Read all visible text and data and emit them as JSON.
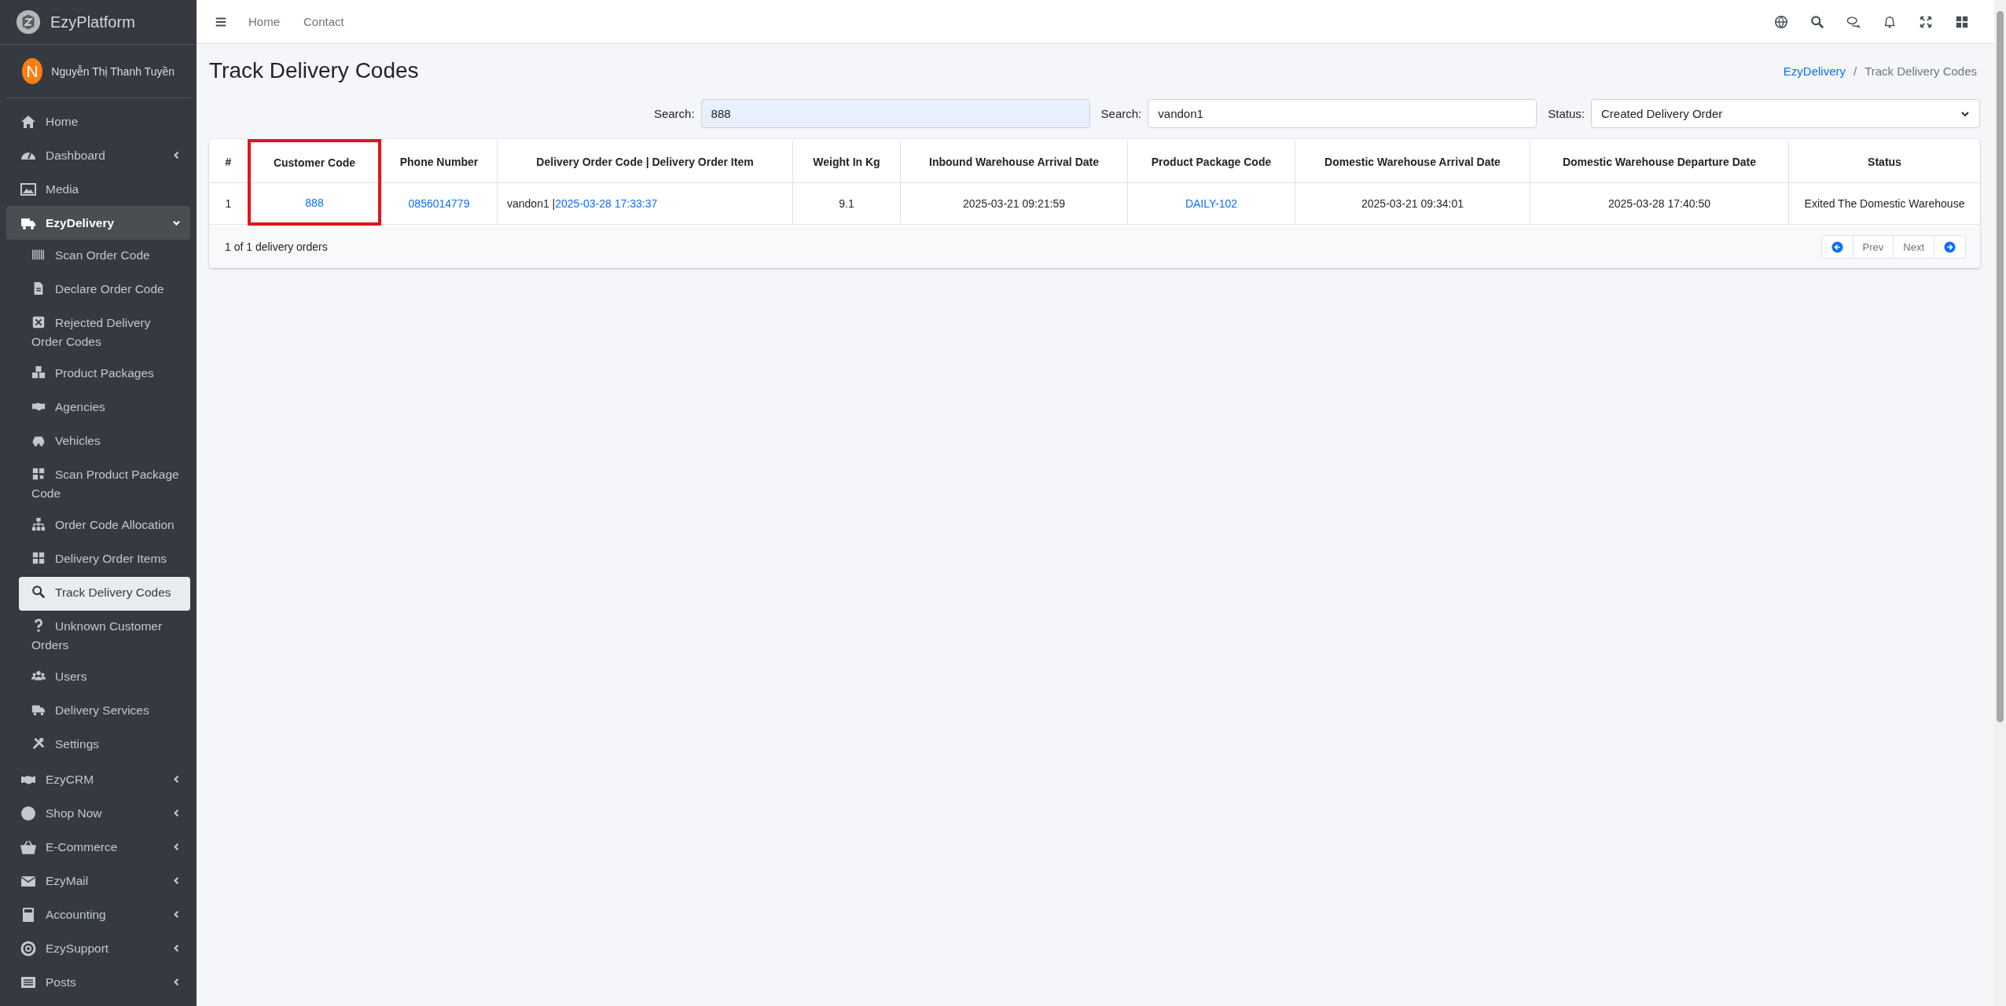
{
  "brand": {
    "name": "EzyPlatform"
  },
  "user": {
    "initial": "N",
    "name": "Nguyễn Thị Thanh Tuyền"
  },
  "sidebar": {
    "items": [
      {
        "label": "Home",
        "kind": "link"
      },
      {
        "label": "Dashboard",
        "kind": "group",
        "expanded": false
      },
      {
        "label": "Media",
        "kind": "link"
      },
      {
        "label": "EzyDelivery",
        "kind": "group",
        "expanded": true,
        "children": [
          {
            "label": "Scan Order Code",
            "selected": false
          },
          {
            "label": "Declare Order Code",
            "selected": false
          },
          {
            "label": "Rejected Delivery Order Codes",
            "selected": false
          },
          {
            "label": "Product Packages",
            "selected": false
          },
          {
            "label": "Agencies",
            "selected": false
          },
          {
            "label": "Vehicles",
            "selected": false
          },
          {
            "label": "Scan Product Package Code",
            "selected": false
          },
          {
            "label": "Order Code Allocation",
            "selected": false
          },
          {
            "label": "Delivery Order Items",
            "selected": false
          },
          {
            "label": "Track Delivery Codes",
            "selected": true
          },
          {
            "label": "Unknown Customer Orders",
            "selected": false
          },
          {
            "label": "Users",
            "selected": false
          },
          {
            "label": "Delivery Services",
            "selected": false
          },
          {
            "label": "Settings",
            "selected": false
          }
        ]
      },
      {
        "label": "EzyCRM",
        "kind": "group",
        "expanded": false
      },
      {
        "label": "Shop Now",
        "kind": "group",
        "expanded": false
      },
      {
        "label": "E-Commerce",
        "kind": "group",
        "expanded": false
      },
      {
        "label": "EzyMail",
        "kind": "group",
        "expanded": false
      },
      {
        "label": "Accounting",
        "kind": "group",
        "expanded": false
      },
      {
        "label": "EzySupport",
        "kind": "group",
        "expanded": false
      },
      {
        "label": "Posts",
        "kind": "group",
        "expanded": false
      }
    ]
  },
  "topbar": {
    "links": [
      "Home",
      "Contact"
    ]
  },
  "page": {
    "title": "Track Delivery Codes",
    "breadcrumb_separator": "/",
    "breadcrumb": [
      {
        "label": "EzyDelivery",
        "kind": "link"
      },
      {
        "label": "Track Delivery Codes",
        "kind": "current"
      }
    ]
  },
  "filters": [
    {
      "label": "Search:",
      "kind": "input",
      "value": "888",
      "focused": true
    },
    {
      "label": "Search:",
      "kind": "input",
      "value": "vandon1",
      "focused": false
    },
    {
      "label": "Status:",
      "kind": "select",
      "value": "Created Delivery Order",
      "focused": false
    }
  ],
  "table": {
    "columns": [
      {
        "label": "#",
        "highlighted": false
      },
      {
        "label": "Customer Code",
        "highlighted": true
      },
      {
        "label": "Phone Number",
        "highlighted": false
      },
      {
        "label": "Delivery Order Code | Delivery Order Item",
        "highlighted": false
      },
      {
        "label": "Weight In Kg",
        "highlighted": false
      },
      {
        "label": "Inbound Warehouse Arrival Date",
        "highlighted": false
      },
      {
        "label": "Product Package Code",
        "highlighted": false
      },
      {
        "label": "Domestic Warehouse Arrival Date",
        "highlighted": false
      },
      {
        "label": "Domestic Warehouse Departure Date",
        "highlighted": false
      },
      {
        "label": "Status",
        "highlighted": false
      }
    ],
    "rows": [
      {
        "index": "1",
        "customer_code": "888",
        "phone_number": "0856014779",
        "delivery_order_code": "vandon1 |",
        "delivery_order_item": "2025-03-28 17:33:37",
        "weight_in_kg": "9.1",
        "inbound_warehouse_arrival_date": "2025-03-21 09:21:59",
        "product_package_code": "DAILY-102",
        "domestic_warehouse_arrival_date": "2025-03-21 09:34:01",
        "domestic_warehouse_departure_date": "2025-03-28 17:40:50",
        "status": "Exited The Domestic Warehouse"
      }
    ],
    "summary": "1 of 1 delivery orders",
    "pagination": {
      "prev": "Prev",
      "next": "Next"
    }
  }
}
